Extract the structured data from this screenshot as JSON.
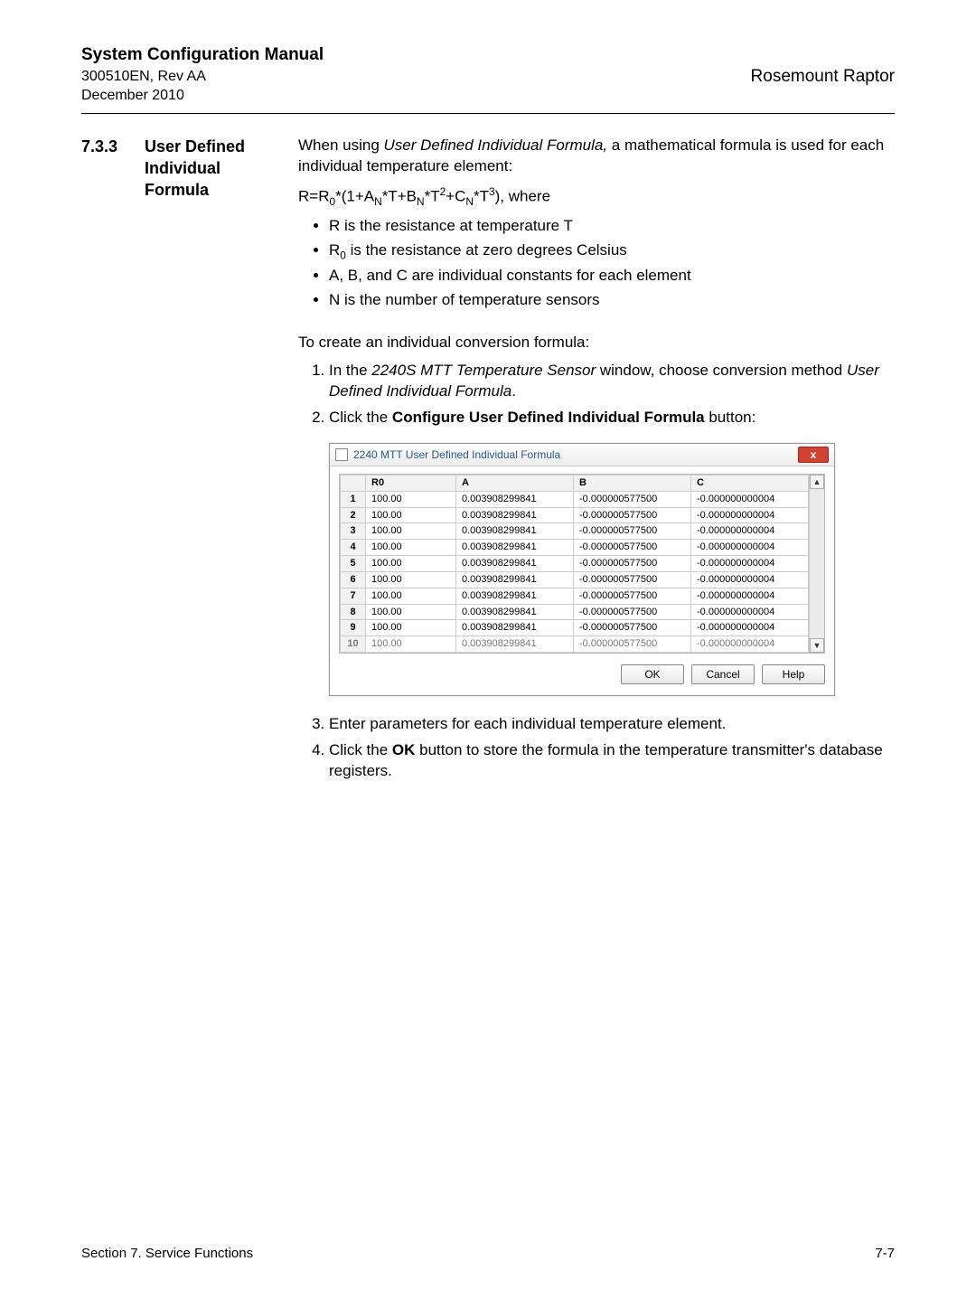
{
  "header": {
    "manual_title": "System Configuration Manual",
    "doc_id": "300510EN, Rev AA",
    "doc_date": "December 2010",
    "brand": "Rosemount Raptor"
  },
  "section": {
    "number": "7.3.3",
    "heading": "User Defined Individual Formula",
    "intro_before_ital": "When using ",
    "intro_ital": "User Defined Individual Formula,",
    "intro_after_ital": " a mathematical formula is used for each individual temperature element:",
    "formula_plain": "R=R0*(1+AN*T+BN*T2+CN*T3), where",
    "bullets": {
      "b1": "R is the resistance at temperature T",
      "b2_prefix": "R",
      "b2_sub": "0",
      "b2_rest": " is the resistance at zero degrees Celsius",
      "b3": "A, B, and C are individual constants for each element",
      "b4": "N is the number of temperature sensors"
    },
    "lead2": "To create an individual conversion formula:",
    "steps": {
      "s1_a": "In the ",
      "s1_ital": "2240S MTT Temperature Sensor",
      "s1_b": " window, choose conversion method ",
      "s1_ital2": "User Defined Individual Formula",
      "s1_c": ".",
      "s2_a": "Click the ",
      "s2_bold": "Configure User Defined Individual Formula",
      "s2_b": " button:",
      "s3": "Enter parameters for each individual temperature element.",
      "s4_a": "Click the ",
      "s4_bold": "OK",
      "s4_b": " button to store the formula in the temperature transmitter's database registers."
    }
  },
  "dialog": {
    "title": "2240 MTT User Defined Individual Formula",
    "close_glyph": "x",
    "headers": {
      "r0": "R0",
      "a": "A",
      "b": "B",
      "c": "C"
    },
    "rows": [
      {
        "idx": "1",
        "r0": "100.00",
        "a": "0.003908299841",
        "b": "-0.000000577500",
        "c": "-0.000000000004"
      },
      {
        "idx": "2",
        "r0": "100.00",
        "a": "0.003908299841",
        "b": "-0.000000577500",
        "c": "-0.000000000004"
      },
      {
        "idx": "3",
        "r0": "100.00",
        "a": "0.003908299841",
        "b": "-0.000000577500",
        "c": "-0.000000000004"
      },
      {
        "idx": "4",
        "r0": "100.00",
        "a": "0.003908299841",
        "b": "-0.000000577500",
        "c": "-0.000000000004"
      },
      {
        "idx": "5",
        "r0": "100.00",
        "a": "0.003908299841",
        "b": "-0.000000577500",
        "c": "-0.000000000004"
      },
      {
        "idx": "6",
        "r0": "100.00",
        "a": "0.003908299841",
        "b": "-0.000000577500",
        "c": "-0.000000000004"
      },
      {
        "idx": "7",
        "r0": "100.00",
        "a": "0.003908299841",
        "b": "-0.000000577500",
        "c": "-0.000000000004"
      },
      {
        "idx": "8",
        "r0": "100.00",
        "a": "0.003908299841",
        "b": "-0.000000577500",
        "c": "-0.000000000004"
      },
      {
        "idx": "9",
        "r0": "100.00",
        "a": "0.003908299841",
        "b": "-0.000000577500",
        "c": "-0.000000000004"
      }
    ],
    "cutoff": {
      "idx": "10",
      "r0": "100.00",
      "a": "0.003908299841",
      "b": "-0.000000577500",
      "c": "-0.000000000004"
    },
    "buttons": {
      "ok": "OK",
      "cancel": "Cancel",
      "help": "Help"
    },
    "scroll": {
      "up": "▲",
      "down": "▼"
    }
  },
  "footer": {
    "left": "Section 7. Service Functions",
    "right": "7-7"
  }
}
